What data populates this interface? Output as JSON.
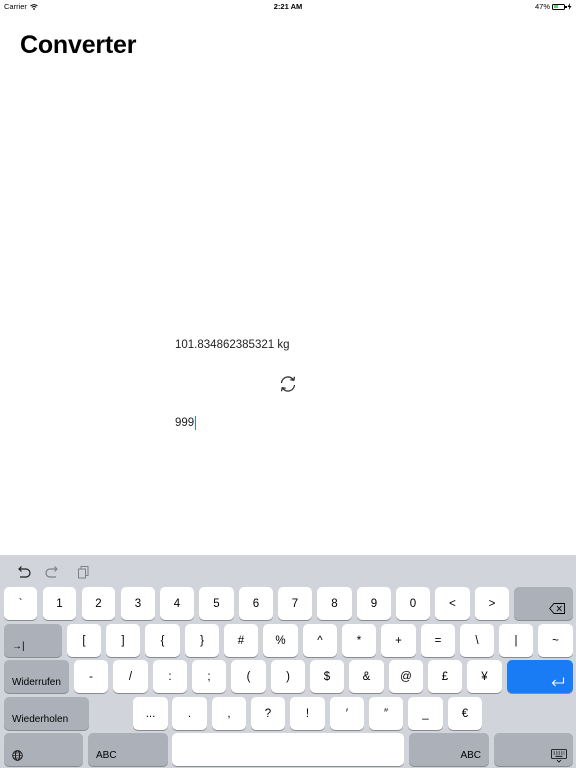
{
  "status_bar": {
    "carrier": "Carrier",
    "time": "2:21 AM",
    "battery": "47%",
    "battery_level": 0.47
  },
  "app": {
    "title": "Converter"
  },
  "converter": {
    "result": "101.834862385321 kg",
    "input_value": "999",
    "swap_icon": "refresh-icon"
  },
  "keyboard": {
    "shortcuts": [
      "undo-icon",
      "redo-icon",
      "paste-icon"
    ],
    "row1": [
      "`",
      "1",
      "2",
      "3",
      "4",
      "5",
      "6",
      "7",
      "8",
      "9",
      "0",
      "<",
      ">"
    ],
    "row2_tab": "→|",
    "row2": [
      "[",
      "]",
      "{",
      "}",
      "#",
      "%",
      "^",
      "*",
      "+",
      "=",
      "\\",
      "|",
      "~"
    ],
    "row3_undo": "Widerrufen",
    "row3": [
      "-",
      "/",
      ":",
      ";",
      "(",
      ")",
      "$",
      "&",
      "@",
      "£",
      "¥"
    ],
    "row4_redo": "Wiederholen",
    "row4": [
      "...",
      ".",
      ",",
      "?",
      "!",
      "′",
      "″",
      "_",
      "€"
    ],
    "abc_left": "ABC",
    "abc_right": "ABC",
    "icons": {
      "delete": "backspace-icon",
      "return": "return-icon",
      "globe": "globe-icon",
      "dismiss": "keyboard-dismiss-icon"
    },
    "colors": {
      "background": "#d1d4da",
      "key": "#ffffff",
      "function_key": "#abb0b9",
      "return_key": "#1a7cf5"
    }
  }
}
